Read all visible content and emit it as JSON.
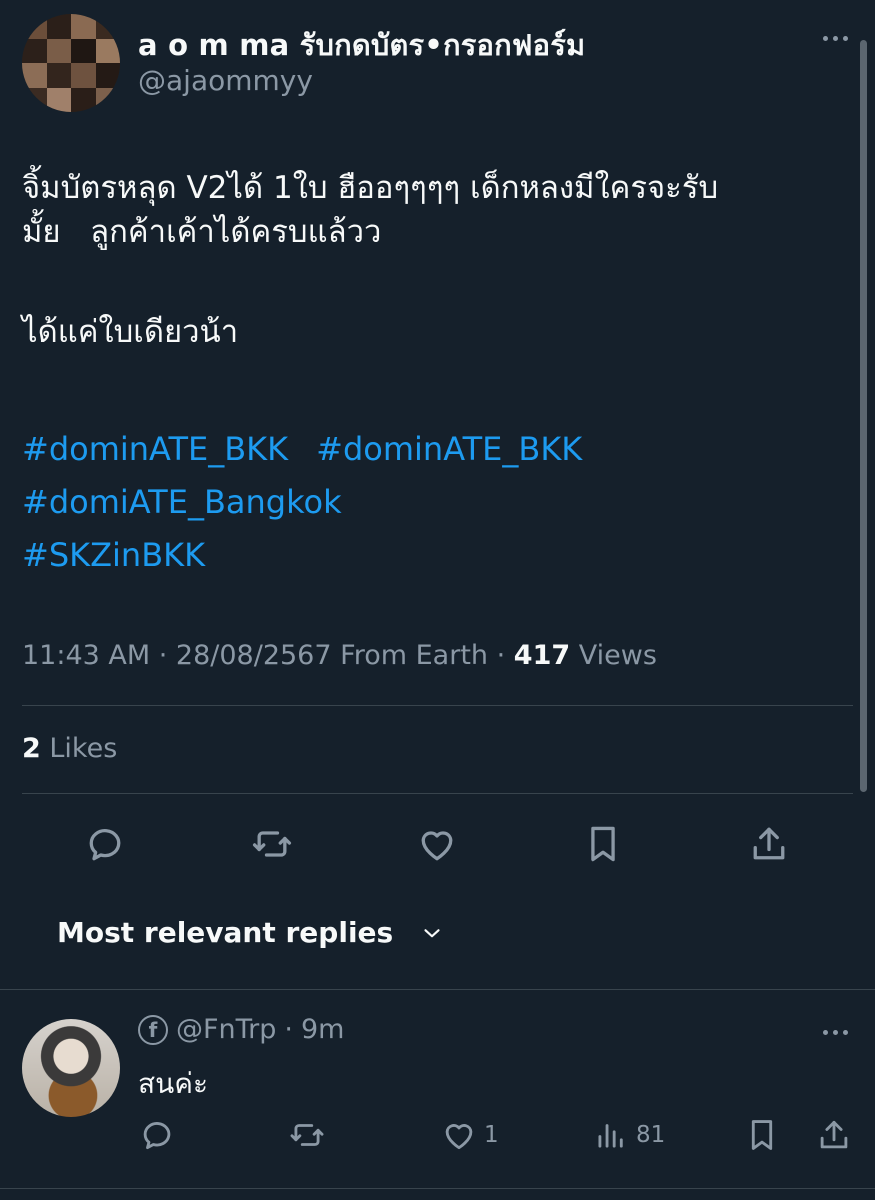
{
  "post": {
    "display_name": "a o m ma รับกดบัตร•กรอกฟอร์ม",
    "handle": "@ajaommyy",
    "text_lines": [
      "จิ้มบัตรหลุด V2ได้ 1ใบ ฮืออๆๆๆๆ เด็กหลงมีใครจะรับ",
      "มั้ย   ลูกค้าเค้าได้ครบแล้วว",
      "",
      "ได้แค่ใบเดียวน้า"
    ],
    "hashtags_row1": [
      "#dominATE_BKK",
      "#dominATE_BKK"
    ],
    "hashtag_row2": "#domiATE_Bangkok",
    "hashtag_row3": "#SKZinBKK",
    "time": "11:43 AM",
    "date": "28/08/2567",
    "location": "From Earth",
    "views_count": "417",
    "views_label": "Views",
    "likes_count": "2",
    "likes_label": "Likes"
  },
  "replies_sort": {
    "label": "Most relevant replies"
  },
  "reply": {
    "platform_letter": "f",
    "handle": "@FnTrp",
    "age": "9m",
    "text": "สนค่ะ",
    "likes": "1",
    "views": "81"
  },
  "icons": {
    "reply": "reply-icon",
    "repost": "repost-icon",
    "like": "heart-icon",
    "bookmark": "bookmark-icon",
    "share": "share-icon",
    "views": "views-icon",
    "more": "more-icon",
    "chevron": "chevron-down-icon"
  },
  "colors": {
    "background": "#15202b",
    "text": "#f7f9f9",
    "secondary": "#8b98a5",
    "link": "#1d9bf0",
    "divider": "#38444d"
  }
}
